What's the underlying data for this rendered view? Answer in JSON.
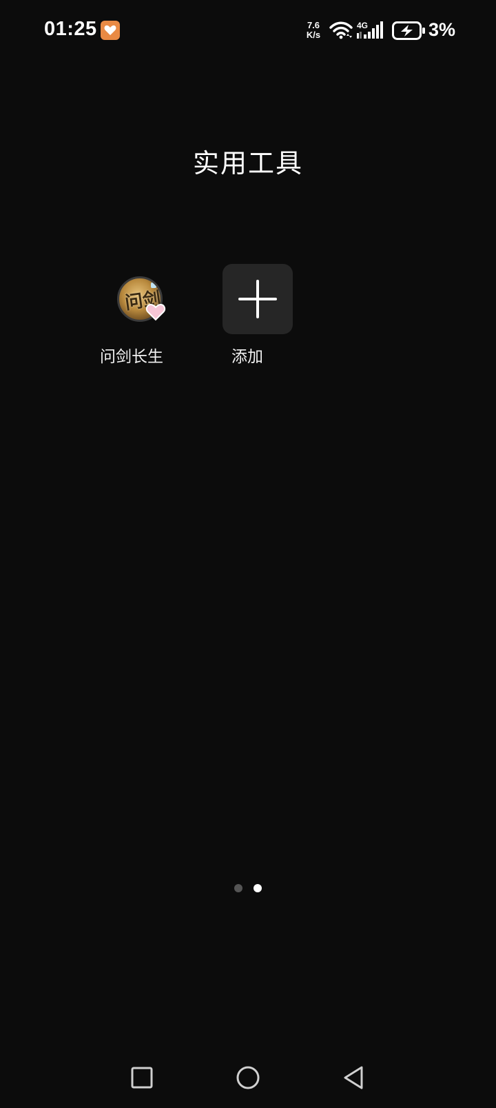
{
  "status_bar": {
    "time": "01:25",
    "notification_icon": "heart-app-icon",
    "net_speed_value": "7.6",
    "net_speed_unit": "K/s",
    "network_type": "4G",
    "battery_percent": "3%",
    "battery_state": "charging"
  },
  "folder": {
    "title": "实用工具",
    "apps": [
      {
        "label": "问剑长生",
        "icon": "game-icon",
        "icon_glyph": "问剑"
      },
      {
        "label": "添加",
        "icon": "plus-icon"
      }
    ]
  },
  "page_indicator": {
    "pages": 2,
    "current": 2
  },
  "navigation": {
    "buttons": [
      "recents-icon",
      "home-icon",
      "back-icon"
    ]
  },
  "colors": {
    "background": "#0c0c0c",
    "add_tile": "#262626",
    "notification_icon": "#e98a44",
    "indicator_inactive": "#555555",
    "indicator_active": "#ffffff"
  }
}
